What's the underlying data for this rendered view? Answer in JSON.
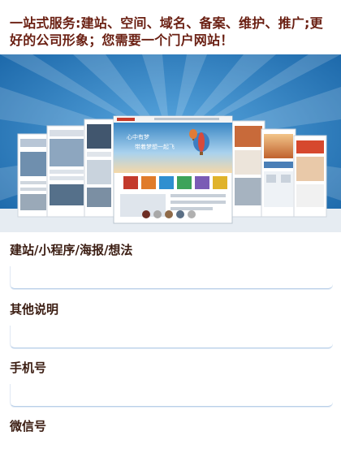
{
  "header": {
    "headline": "一站式服务:建站、空间、域名、备案、维护、推广;更好的公司形象；您需要一个门户网站！"
  },
  "banner": {
    "image_name": "website-templates-banner",
    "colors": {
      "sky": "#1d6fb0",
      "ray": "#3d8fd0",
      "floor": "#dfe6ee"
    },
    "mockup_text_1": "心中有梦",
    "mockup_text_2": "带着梦想一起飞"
  },
  "form": {
    "fields": [
      {
        "label": "建站/小程序/海报/想法",
        "value": "",
        "placeholder": ""
      },
      {
        "label": "其他说明",
        "value": "",
        "placeholder": ""
      },
      {
        "label": "手机号",
        "value": "",
        "placeholder": ""
      },
      {
        "label": "微信号",
        "value": "",
        "placeholder": ""
      }
    ]
  }
}
